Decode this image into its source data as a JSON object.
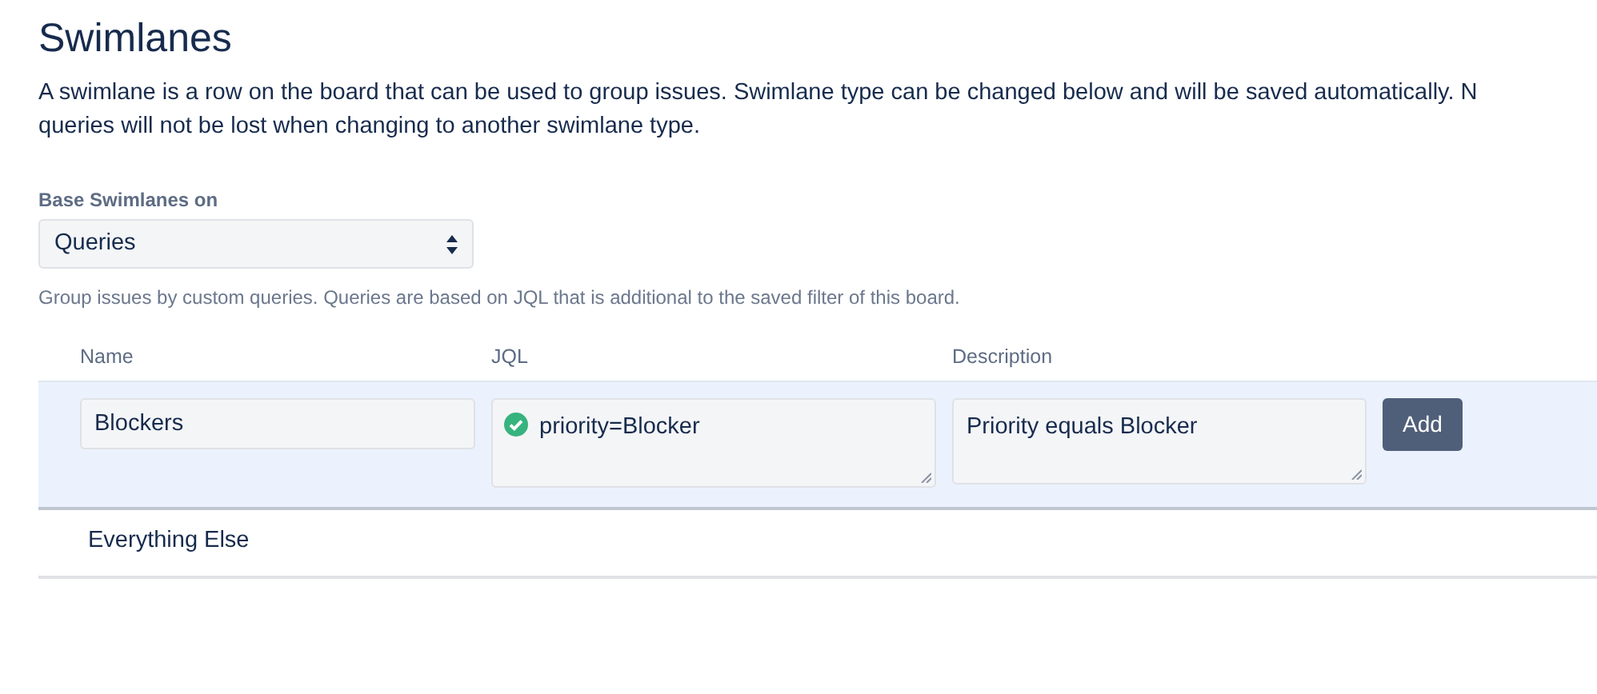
{
  "title": "Swimlanes",
  "description_lines": [
    "A swimlane is a row on the board that can be used to group issues. Swimlane type can be changed below and will be saved automatically. N",
    "queries will not be lost when changing to another swimlane type."
  ],
  "base_select": {
    "label": "Base Swimlanes on",
    "value": "Queries"
  },
  "help": "Group issues by custom queries. Queries are based on JQL that is additional to the saved filter of this board.",
  "table": {
    "columns": [
      "Name",
      "JQL",
      "Description"
    ],
    "new_row": {
      "name": "Blockers",
      "jql": "priority=Blocker",
      "jql_valid": true,
      "description": "Priority equals Blocker",
      "button": "Add"
    },
    "rows": [
      {
        "name": "Everything Else"
      }
    ]
  }
}
